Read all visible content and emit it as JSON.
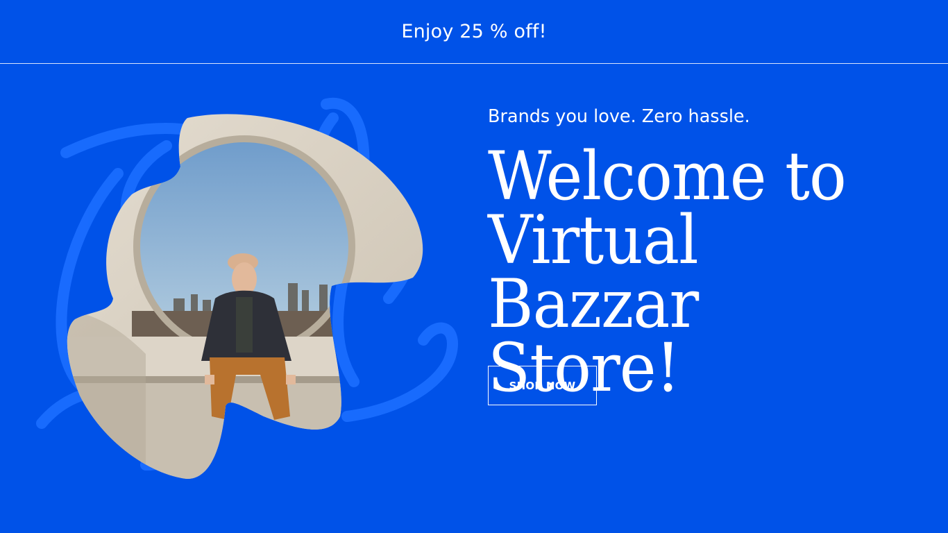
{
  "announcement": {
    "text": "Enjoy 25 % off!"
  },
  "hero": {
    "tagline": "Brands you love. Zero hassle.",
    "headline_lines": [
      "Welcome to",
      "Virtual",
      "Bazzar Store!"
    ],
    "cta_label": "SHOP NOW"
  },
  "colors": {
    "background": "#0052e8",
    "scribble": "#1a6dff",
    "text": "#ffffff",
    "frame": "#d9d1c4"
  }
}
